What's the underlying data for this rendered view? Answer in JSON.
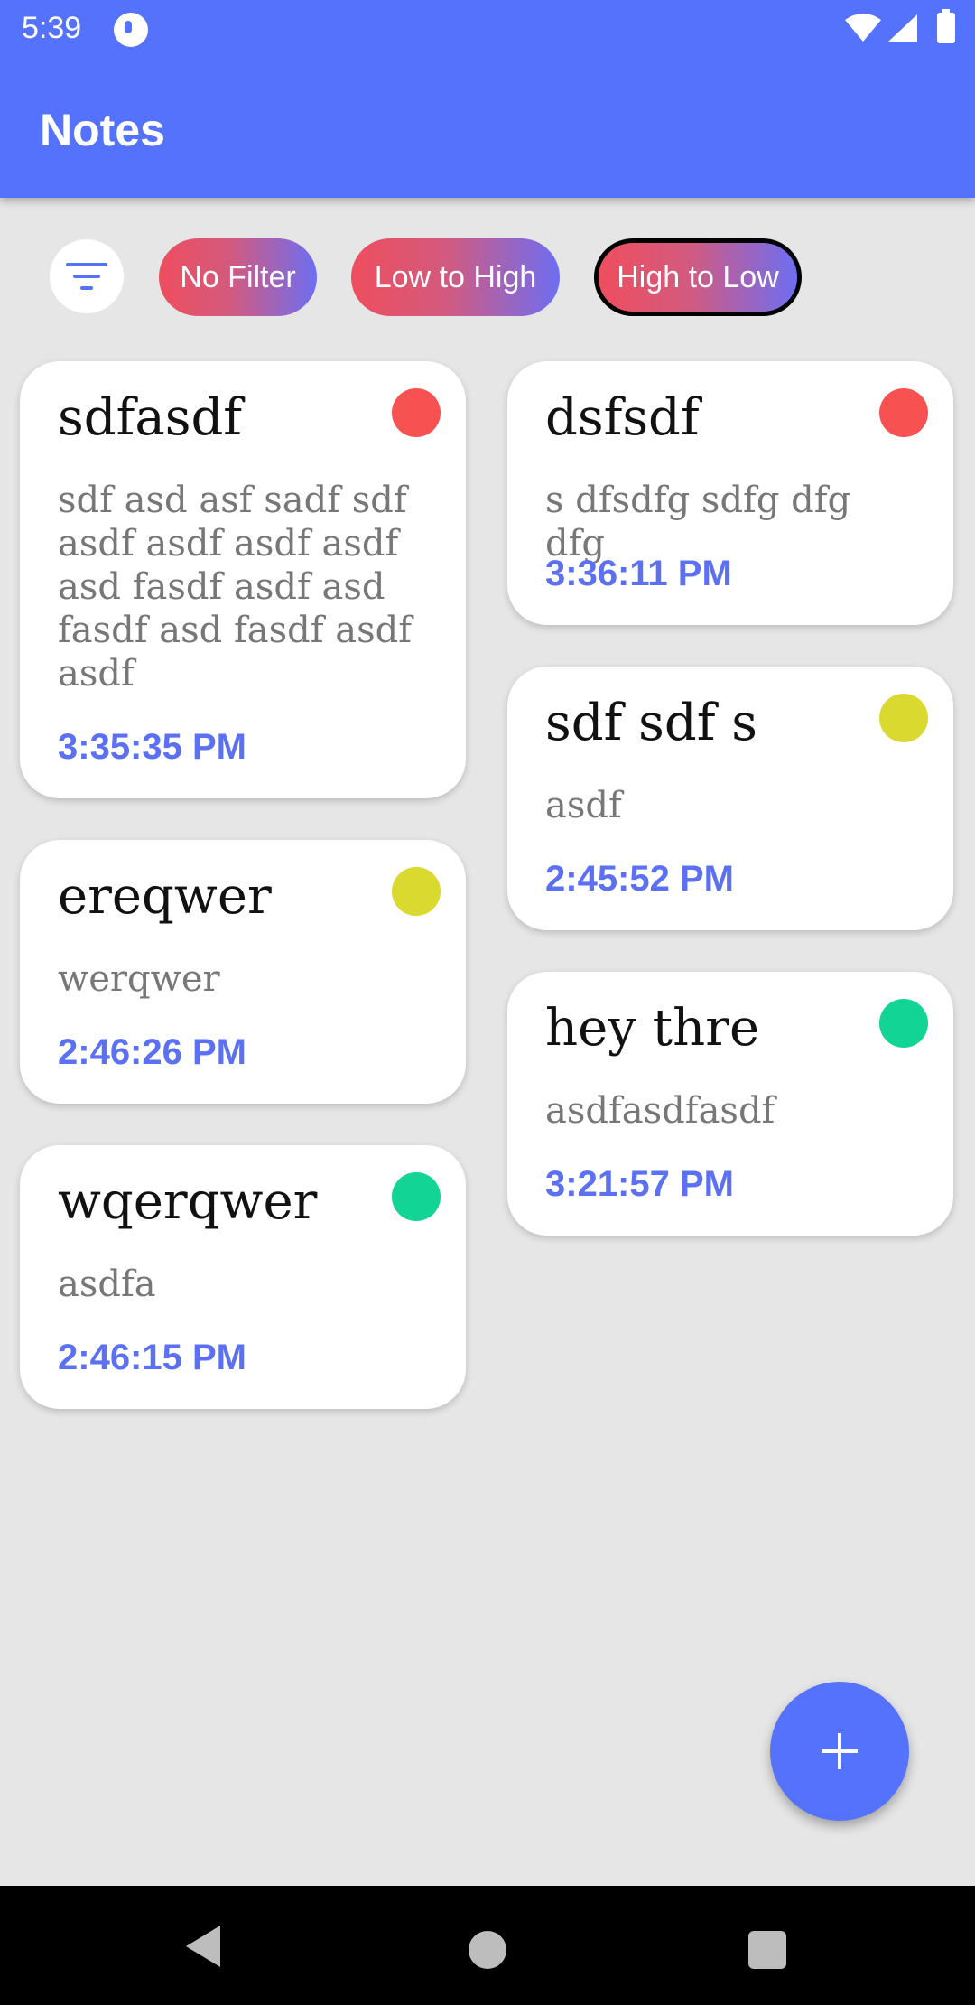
{
  "status_bar": {
    "time": "5:39",
    "icons": [
      "notification-icon",
      "wifi-icon",
      "signal-icon",
      "battery-icon"
    ]
  },
  "app_bar": {
    "title": "Notes"
  },
  "filters": {
    "filter_icon": "filter-lines-icon",
    "chips": [
      {
        "label": "No Filter",
        "selected": false
      },
      {
        "label": "Low to High",
        "selected": false
      },
      {
        "label": "High to Low",
        "selected": true
      }
    ]
  },
  "colors": {
    "primary": "#5472fb",
    "priority_high": "#f75152",
    "priority_medium": "#d9d92f",
    "priority_low": "#12d494"
  },
  "notes": [
    {
      "title": "sdfasdf",
      "body": "sdf asd asf sadf sdf asdf asdf asdf asdf asd fasdf asdf asd fasdf asd fasdf asdf asdf",
      "time": "3:35:35 PM",
      "priority_color": "#f75152"
    },
    {
      "title": "dsfsdf",
      "body": "s dfsdfg sdfg dfg dfg",
      "time": "3:36:11 PM",
      "priority_color": "#f75152"
    },
    {
      "title": "sdf sdf s",
      "body": "asdf",
      "time": "2:45:52 PM",
      "priority_color": "#d9d92f"
    },
    {
      "title": "ereqwer",
      "body": "werqwer",
      "time": "2:46:26 PM",
      "priority_color": "#d9d92f"
    },
    {
      "title": "hey thre",
      "body": "asdfasdfasdf",
      "time": "3:21:57 PM",
      "priority_color": "#12d494"
    },
    {
      "title": "wqerqwer",
      "body": "asdfa",
      "time": "2:46:15 PM",
      "priority_color": "#12d494"
    }
  ],
  "fab": {
    "icon": "plus-icon"
  },
  "nav_bar": {
    "icons": [
      "back-icon",
      "home-icon",
      "recents-icon"
    ]
  }
}
